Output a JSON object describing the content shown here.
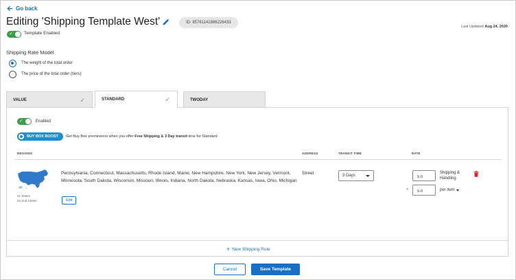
{
  "header": {
    "back_label": "Go back",
    "title": "Editing 'Shipping Template West'",
    "id_label": "ID: 85761141886226433",
    "last_updated_label": "Last Updated",
    "last_updated_date": "Aug 24, 2020",
    "template_enabled_label": "Template Enabled",
    "template_enabled": true
  },
  "rate_model": {
    "label": "Shipping Rate Model",
    "options": [
      {
        "label": "The weight of the total order",
        "selected": true
      },
      {
        "label": "The price of the total order (tiers)",
        "selected": false
      }
    ]
  },
  "tabs": [
    {
      "label": "VALUE",
      "checked": true,
      "active": false
    },
    {
      "label": "STANDARD",
      "checked": true,
      "active": true
    },
    {
      "label": "TWODAY",
      "checked": false,
      "active": false
    }
  ],
  "panel": {
    "enabled_label": "Enabled",
    "enabled": true,
    "boost_button": "BUY BOX BOOST",
    "boost_text_pre": "Get Buy Box prominence when you offer ",
    "boost_text_bold": "Free Shipping & 3 Day transit",
    "boost_text_post": " time for Standard",
    "columns": {
      "regions": "REGIONS",
      "address": "ADDRESS",
      "transit": "TRANSIT TIME",
      "rate": "RATE"
    },
    "rule": {
      "states_count": "21 States",
      "substates_count": "54 Sub-States",
      "edit_label": "Edit",
      "regions": "Pennsylvania, Connecticut, Massachusetts, Rhode Island, Maine, New Hampshire, New York, New Jersey, Vermont, Minnesota, South Dakota, Wisconsin, Missouri, Illinois, Indiana, North Dakota, Nebraska, Kansas, Iowa, Ohio, Michigan",
      "address": "Street",
      "transit_time": "3 Days",
      "rate_shipping": "5.0",
      "rate_shipping_label_1": "Shipping &",
      "rate_shipping_label_2": "Handling",
      "plus": "+",
      "rate_per_item": "5.0",
      "rate_per_item_label": "per item"
    },
    "new_rule_label": "New Shipping Rule"
  },
  "footer": {
    "cancel_label": "Cancel",
    "save_label": "Save Template"
  },
  "colors": {
    "accent": "#1a6fc4",
    "toggle_on": "#3e9c4a",
    "boost": "#1a8fd6",
    "map": "#2f7ac9",
    "delete": "#e02424"
  }
}
